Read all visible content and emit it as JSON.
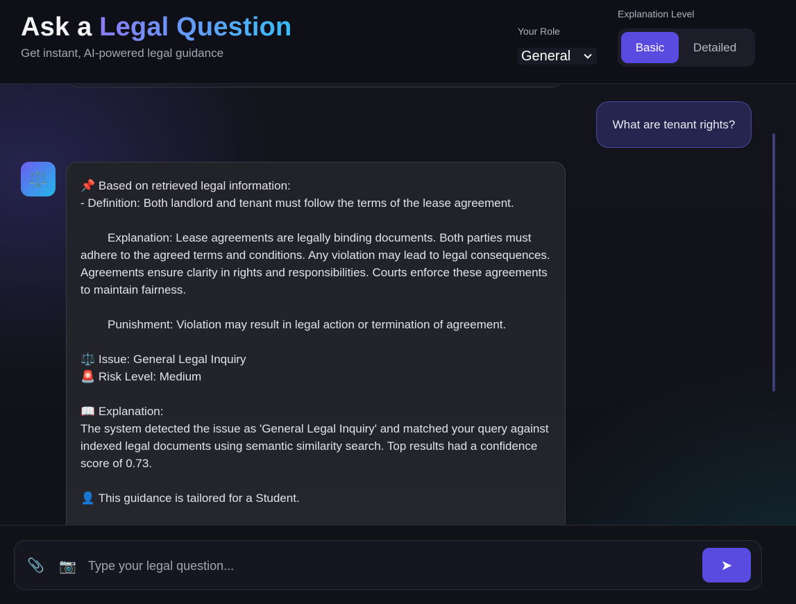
{
  "header": {
    "title_prefix": "Ask a ",
    "title_accent": "Legal Question",
    "subtitle": "Get instant, AI-powered legal guidance",
    "role_label": "Your Role",
    "role_selected": "General",
    "level_label": "Explanation Level",
    "level_options": [
      "Basic",
      "Detailed"
    ],
    "level_active": "Basic"
  },
  "chat": {
    "user_message": "What are tenant rights?",
    "bot_avatar_icon": "⚖️",
    "bot_lines": [
      "📌 Based on retrieved legal information:",
      "- Definition: Both landlord and tenant must follow the terms of the lease agreement.",
      "Explanation: Lease agreements are legally binding documents. Both parties must adhere to the agreed terms and conditions. Any violation may lead to legal consequences. Agreements ensure clarity in rights and responsibilities. Courts enforce these agreements to maintain fairness.",
      "Punishment: Violation may result in legal action or termination of agreement.",
      "⚖️ Issue: General Legal Inquiry",
      "🚨 Risk Level: Medium",
      "📖 Explanation:",
      "The system detected the issue as 'General Legal Inquiry' and matched your query against indexed legal documents using semantic similarity search. Top results had a confidence score of 0.73.",
      "👤 This guidance is tailored for a Student."
    ]
  },
  "composer": {
    "placeholder": "Type your legal question...",
    "value": "",
    "attach_icon": "📎",
    "camera_icon": "📷",
    "send_icon": "➤"
  },
  "colors": {
    "accent": "#5a4be0",
    "title_gradient_start": "#8b7cf6",
    "title_gradient_end": "#38bdf8",
    "background": "#121318"
  }
}
